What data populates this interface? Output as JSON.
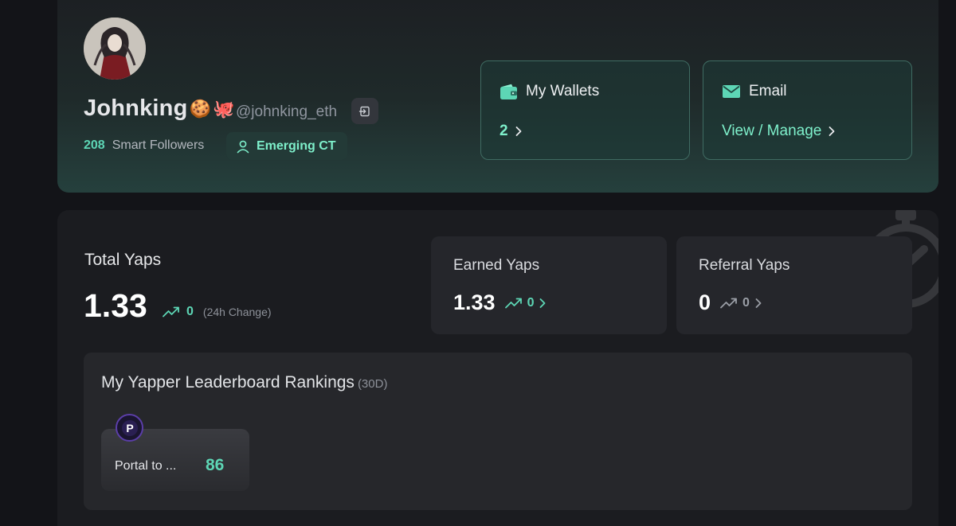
{
  "profile": {
    "display_name": "Johnking",
    "name_emojis": [
      "🍪",
      "🐙"
    ],
    "handle": "@johnking_eth",
    "smart_followers_count": "208",
    "smart_followers_label": "Smart Followers",
    "tier": "Emerging CT"
  },
  "wallets": {
    "title": "My Wallets",
    "value": "2"
  },
  "email": {
    "title": "Email",
    "action": "View / Manage"
  },
  "yaps": {
    "total": {
      "title": "Total Yaps",
      "value": "1.33",
      "change": "0",
      "change_note": "(24h Change)"
    },
    "earned": {
      "title": "Earned Yaps",
      "value": "1.33",
      "change": "0"
    },
    "referral": {
      "title": "Referral Yaps",
      "value": "0",
      "change": "0"
    }
  },
  "leaderboard": {
    "title": "My Yapper Leaderboard Rankings",
    "period": "(30D)",
    "items": [
      {
        "name": "Portal to ...",
        "rank": "86",
        "logo_letter": "P"
      }
    ]
  },
  "colors": {
    "accent": "#7ef0cb",
    "accent_dim": "#5dd6b5",
    "panel": "#1b1c20",
    "page_bg": "#131418"
  }
}
